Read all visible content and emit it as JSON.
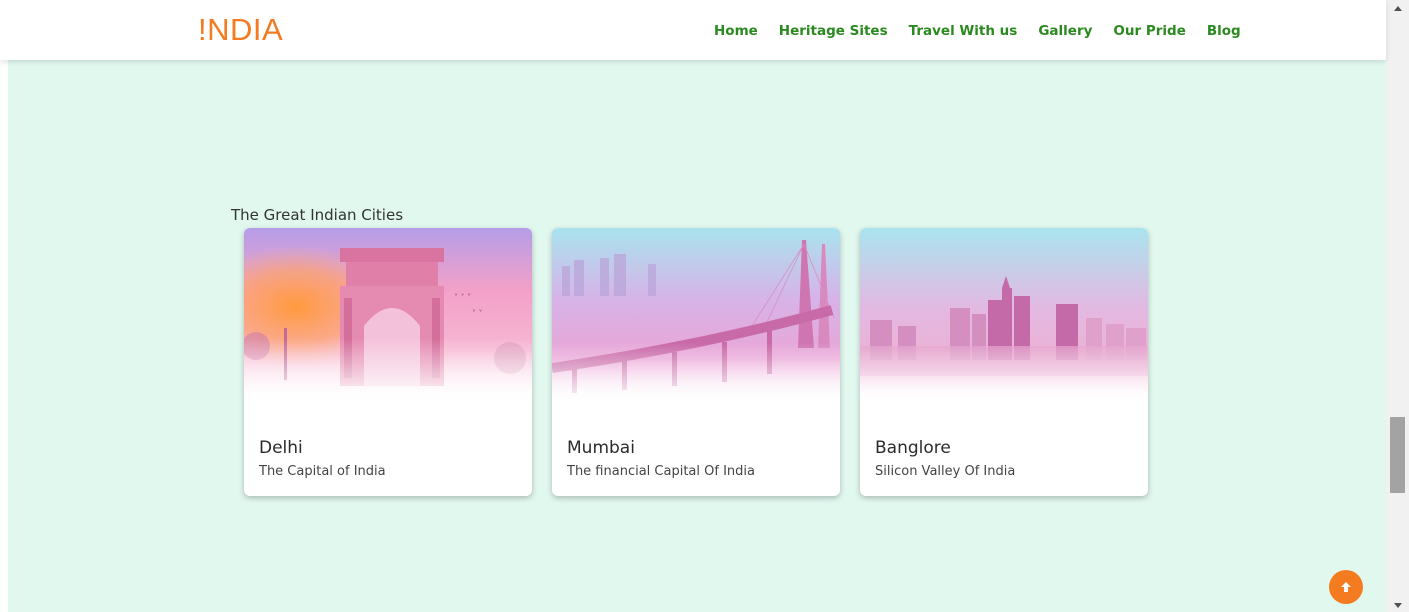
{
  "header": {
    "logo": "!NDIA",
    "nav": [
      "Home",
      "Heritage Sites",
      "Travel With us",
      "Gallery",
      "Our Pride",
      "Blog"
    ]
  },
  "section": {
    "title": "The Great Indian Cities",
    "cards": [
      {
        "title": "Delhi",
        "subtitle": "The Capital of India",
        "image": "india-gate-image"
      },
      {
        "title": "Mumbai",
        "subtitle": "The financial Capital Of India",
        "image": "sea-link-bridge-image"
      },
      {
        "title": "Banglore",
        "subtitle": "Silicon Valley Of India",
        "image": "city-skyline-image"
      }
    ]
  },
  "colors": {
    "brand": "#f47b20",
    "nav": "#2a8a1f",
    "background": "#e1f8ef"
  },
  "icons": {
    "back_to_top": "arrow-up-icon"
  }
}
